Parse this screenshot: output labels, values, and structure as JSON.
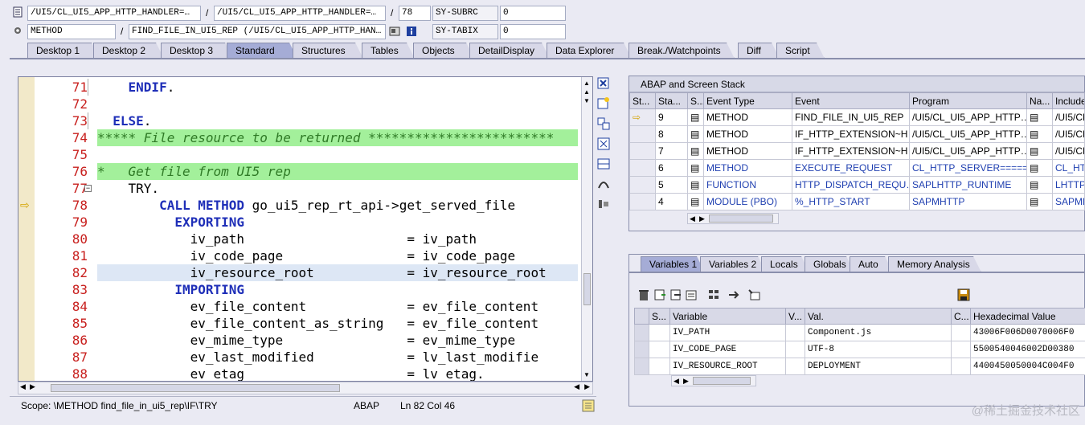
{
  "header": {
    "row1": {
      "program": "/UI5/CL_UI5_APP_HTTP_HANDLER=…",
      "include": "/UI5/CL_UI5_APP_HTTP_HANDLER=…",
      "line": "78",
      "sysfield": "SY-SUBRC",
      "sysvalue": "0"
    },
    "row2": {
      "type": "METHOD",
      "event": "FIND_FILE_IN_UI5_REP (/UI5/CL_UI5_APP_HTTP_HAN…",
      "sysfield": "SY-TABIX",
      "sysvalue": "0"
    }
  },
  "tabs": [
    "Desktop 1",
    "Desktop 2",
    "Desktop 3",
    "Standard",
    "Structures",
    "Tables",
    "Objects",
    "DetailDisplay",
    "Data Explorer",
    "Break./Watchpoints",
    "Diff",
    "Script"
  ],
  "active_tab": "Standard",
  "code": {
    "lines": [
      {
        "n": "71",
        "pre": "    ",
        "kw": "ENDIF",
        "post": "."
      },
      {
        "n": "72",
        "pre": "",
        "kw": "",
        "post": ""
      },
      {
        "n": "73",
        "pre": "  ",
        "kw": "ELSE",
        "post": "."
      },
      {
        "n": "74",
        "comment": "***** File resource to be returned ************************"
      },
      {
        "n": "75",
        "pre": "",
        "kw": "",
        "post": ""
      },
      {
        "n": "76",
        "comment": "*   Get file from UI5 rep"
      },
      {
        "n": "77",
        "pre": "    ",
        "plain": "TRY."
      },
      {
        "n": "78",
        "pre": "        ",
        "kw": "CALL METHOD",
        "post": " go_ui5_rep_rt_api->get_served_file"
      },
      {
        "n": "79",
        "pre": "          ",
        "kw": "EXPORTING",
        "post": ""
      },
      {
        "n": "80",
        "pre": "            ",
        "plain": "iv_path                     = iv_path"
      },
      {
        "n": "81",
        "pre": "            ",
        "plain": "iv_code_page                = iv_code_page"
      },
      {
        "n": "82",
        "pre": "            ",
        "plain": "iv_resource_root            = iv_resource_root"
      },
      {
        "n": "83",
        "pre": "          ",
        "kw": "IMPORTING",
        "post": ""
      },
      {
        "n": "84",
        "pre": "            ",
        "plain": "ev_file_content             = ev_file_content"
      },
      {
        "n": "85",
        "pre": "            ",
        "plain": "ev_file_content_as_string   = ev_file_content"
      },
      {
        "n": "86",
        "pre": "            ",
        "plain": "ev_mime_type                = ev_mime_type"
      },
      {
        "n": "87",
        "pre": "            ",
        "plain": "ev_last_modified            = lv_last_modifie"
      },
      {
        "n": "88",
        "pre": "            ",
        "plain": "ev_etag                     = lv_etag."
      }
    ]
  },
  "status": {
    "scope": "Scope: \\METHOD find_file_in_ui5_rep\\IF\\TRY",
    "lang": "ABAP",
    "pos": "Ln  82 Col  46"
  },
  "stack": {
    "title": "ABAP and Screen Stack",
    "columns": [
      "St...",
      "Sta...",
      "S...",
      "Event Type",
      "Event",
      "Program",
      "Na...",
      "Include"
    ],
    "rows": [
      {
        "level": "9",
        "type": "METHOD",
        "event": "FIND_FILE_IN_UI5_REP",
        "program": "/UI5/CL_UI5_APP_HTTP…",
        "include": "/UI5/CL",
        "current": true,
        "blue": false
      },
      {
        "level": "8",
        "type": "METHOD",
        "event": "IF_HTTP_EXTENSION~H…",
        "program": "/UI5/CL_UI5_APP_HTTP…",
        "include": "/UI5/CL",
        "current": false,
        "blue": false
      },
      {
        "level": "7",
        "type": "METHOD",
        "event": "IF_HTTP_EXTENSION~H…",
        "program": "/UI5/CL_UI5_APP_HTTP…",
        "include": "/UI5/CL",
        "current": false,
        "blue": false
      },
      {
        "level": "6",
        "type": "METHOD",
        "event": "EXECUTE_REQUEST",
        "program": "CL_HTTP_SERVER=====…",
        "include": "CL_HTTP",
        "current": false,
        "blue": true
      },
      {
        "level": "5",
        "type": "FUNCTION",
        "event": "HTTP_DISPATCH_REQU…",
        "program": "SAPLHTTP_RUNTIME",
        "include": "LHTTP_",
        "current": false,
        "blue": true
      },
      {
        "level": "4",
        "type": "MODULE (PBO)",
        "event": "%_HTTP_START",
        "program": "SAPMHTTP",
        "include": "SAPMHT",
        "current": false,
        "blue": true
      }
    ]
  },
  "vars": {
    "tabs": [
      "Variables 1",
      "Variables 2",
      "Locals",
      "Globals",
      "Auto",
      "Memory Analysis"
    ],
    "active_tab": "Variables 1",
    "columns": [
      "S...",
      "Variable",
      "V...",
      "Val.",
      "C...",
      "Hexadecimal Value"
    ],
    "rows": [
      {
        "name": "IV_PATH",
        "value": "Component.js",
        "hex": "43006F006D0070006F0"
      },
      {
        "name": "IV_CODE_PAGE",
        "value": "UTF-8",
        "hex": "5500540046002D00380"
      },
      {
        "name": "IV_RESOURCE_ROOT",
        "value": "DEPLOYMENT",
        "hex": "4400450050004C004F0"
      }
    ]
  },
  "watermark": "@稀土掘金技术社区",
  "colors": {
    "accent_tab": "#a5acd6",
    "comment_bg": "#a3f09b",
    "line_number": "#c8201e",
    "keyword": "#1f2fb8"
  }
}
